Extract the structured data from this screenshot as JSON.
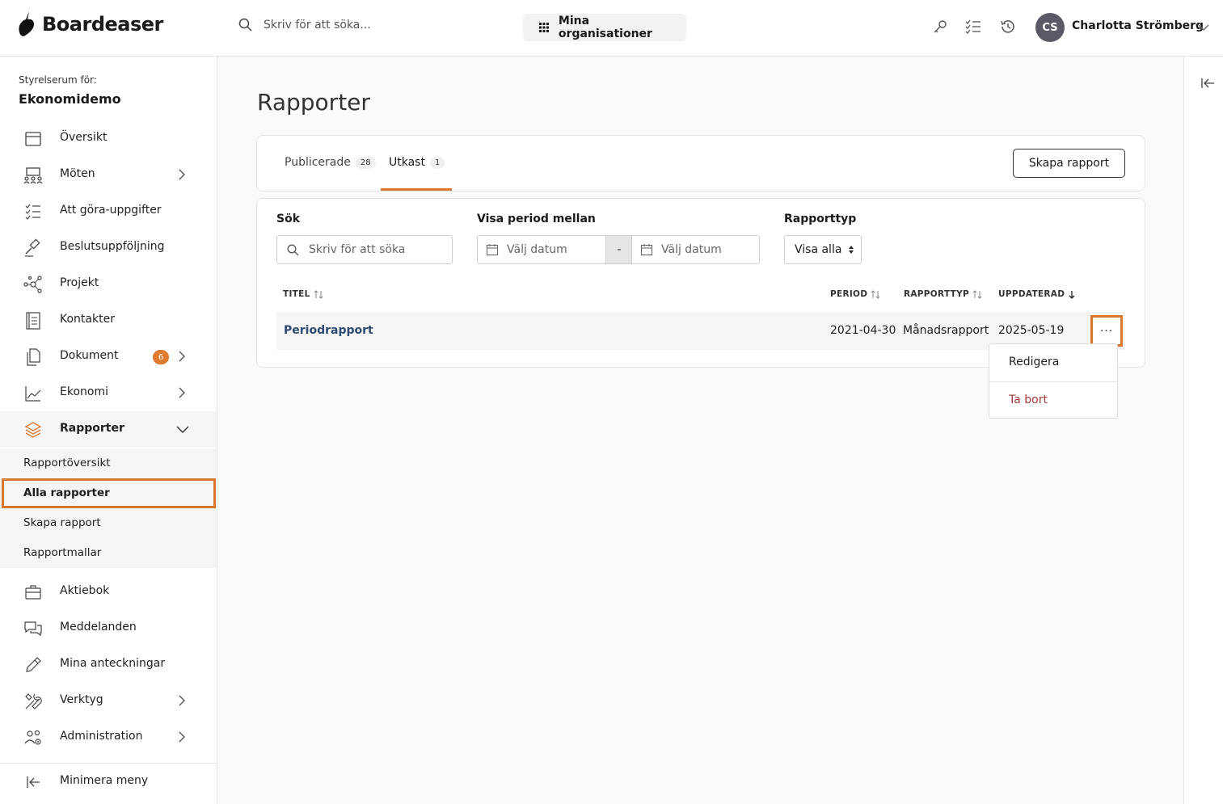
{
  "header": {
    "logo_text": "Boardeaser",
    "search_placeholder": "Skriv för att söka...",
    "org_button": "Mina organisationer",
    "user_initials": "CS",
    "user_name": "Charlotta Strömberg"
  },
  "sidebar": {
    "caption": "Styrelserum för:",
    "org_name": "Ekonomidemo",
    "items": [
      {
        "label": "Översikt",
        "icon": "calendar-icon"
      },
      {
        "label": "Möten",
        "icon": "meeting-icon"
      },
      {
        "label": "Att göra-uppgifter",
        "icon": "checklist-icon"
      },
      {
        "label": "Beslutsuppföljning",
        "icon": "gavel-icon"
      },
      {
        "label": "Projekt",
        "icon": "network-icon"
      },
      {
        "label": "Kontakter",
        "icon": "contacts-icon"
      },
      {
        "label": "Dokument",
        "icon": "documents-icon",
        "badge": "6"
      },
      {
        "label": "Ekonomi",
        "icon": "chart-icon"
      },
      {
        "label": "Rapporter",
        "icon": "layers-icon"
      },
      {
        "label": "Aktiebok",
        "icon": "briefcase-icon"
      },
      {
        "label": "Meddelanden",
        "icon": "chat-icon"
      },
      {
        "label": "Mina anteckningar",
        "icon": "pencil-icon"
      },
      {
        "label": "Verktyg",
        "icon": "tools-icon"
      },
      {
        "label": "Administration",
        "icon": "admin-icon"
      }
    ],
    "sub_items": [
      "Rapportöversikt",
      "Alla rapporter",
      "Skapa rapport",
      "Rapportmallar"
    ],
    "minimize": "Minimera meny"
  },
  "main": {
    "title": "Rapporter",
    "tabs": [
      {
        "label": "Publicerade",
        "count": "28"
      },
      {
        "label": "Utkast",
        "count": "1"
      }
    ],
    "create_button": "Skapa rapport",
    "filters": {
      "search_label": "Sök",
      "search_placeholder": "Skriv för att söka",
      "period_label": "Visa period mellan",
      "date_placeholder": "Välj datum",
      "date_separator": "-",
      "type_label": "Rapporttyp",
      "type_value": "Visa alla"
    },
    "table": {
      "headers": [
        "TITEL",
        "PERIOD",
        "RAPPORTTYP",
        "UPPDATERAD"
      ],
      "rows": [
        {
          "title": "Periodrapport",
          "period": "2021-04-30",
          "type": "Månadsrapport",
          "updated": "2025-05-19"
        }
      ],
      "more_label": "···"
    },
    "menu": {
      "edit": "Redigera",
      "delete": "Ta bort"
    }
  },
  "colors": {
    "accent": "#d9782f",
    "link": "#2d4a73",
    "danger": "#a23a3a"
  }
}
